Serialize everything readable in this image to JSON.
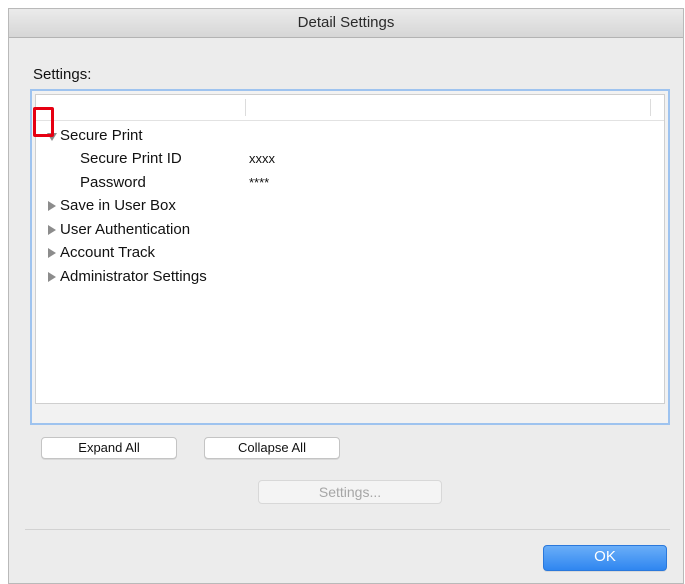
{
  "window": {
    "title": "Detail Settings"
  },
  "settings_label": "Settings:",
  "tree": {
    "items": [
      {
        "label": "Secure Print",
        "expanded": true,
        "children": [
          {
            "label": "Secure Print ID",
            "value": "xxxx"
          },
          {
            "label": "Password",
            "value": "****"
          }
        ]
      },
      {
        "label": "Save in User Box",
        "expanded": false
      },
      {
        "label": "User Authentication",
        "expanded": false
      },
      {
        "label": "Account Track",
        "expanded": false
      },
      {
        "label": "Administrator Settings",
        "expanded": false
      }
    ]
  },
  "buttons": {
    "expand_all": "Expand All",
    "collapse_all": "Collapse All",
    "settings": "Settings...",
    "ok": "OK"
  },
  "colors": {
    "highlight": "#e60012",
    "focus_ring": "#9ec3ef",
    "ok_button": "#2f86f0"
  }
}
